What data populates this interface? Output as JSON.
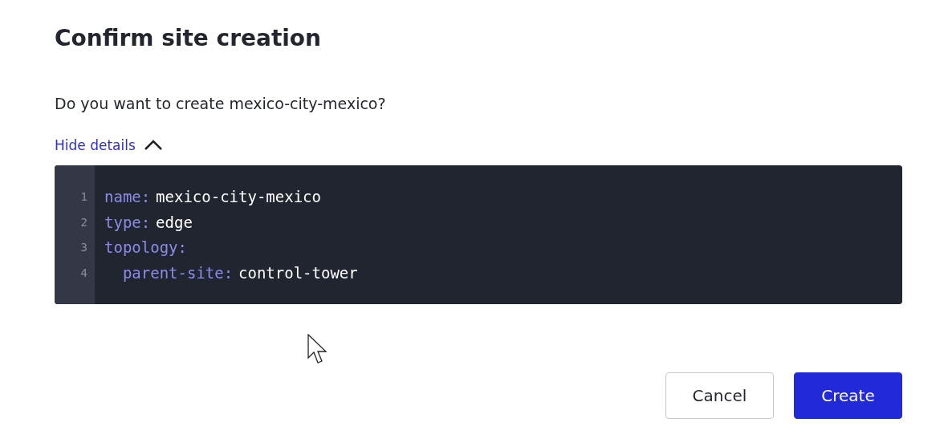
{
  "dialog": {
    "title": "Confirm site creation",
    "message": "Do you want to create mexico-city-mexico?",
    "details_toggle": {
      "label": "Hide details",
      "expanded": true
    },
    "code": {
      "lines": [
        {
          "number": "1",
          "key": "name:",
          "value": "mexico-city-mexico"
        },
        {
          "number": "2",
          "key": "type:",
          "value": "edge"
        },
        {
          "number": "3",
          "key": "topology:",
          "children": [
            {
              "number": "4",
              "key": "parent-site:",
              "value": "control-tower"
            }
          ]
        }
      ]
    },
    "buttons": [
      {
        "label": "Cancel",
        "kind": "secondary"
      },
      {
        "label": "Create",
        "kind": "primary"
      }
    ]
  }
}
